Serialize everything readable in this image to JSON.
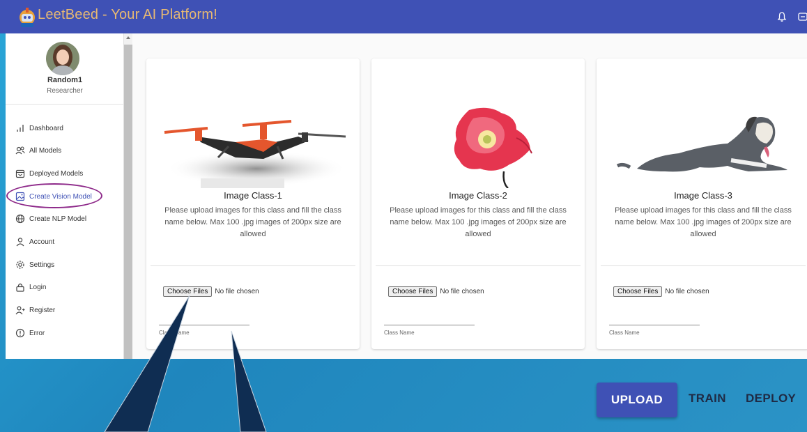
{
  "app": {
    "title": "LeetBeed - Your AI Platform!"
  },
  "user": {
    "name": "Random1",
    "role": "Researcher"
  },
  "sidebar": {
    "items": [
      {
        "label": "Dashboard",
        "icon": "bar-chart-icon"
      },
      {
        "label": "All Models",
        "icon": "users-icon"
      },
      {
        "label": "Deployed Models",
        "icon": "calendar-icon"
      },
      {
        "label": "Create Vision Model",
        "icon": "image-icon",
        "active": true
      },
      {
        "label": "Create NLP Model",
        "icon": "globe-icon"
      },
      {
        "label": "Account",
        "icon": "user-icon"
      },
      {
        "label": "Settings",
        "icon": "gear-icon"
      },
      {
        "label": "Login",
        "icon": "lock-icon"
      },
      {
        "label": "Register",
        "icon": "user-plus-icon"
      },
      {
        "label": "Error",
        "icon": "alert-circle-icon"
      }
    ]
  },
  "cards": [
    {
      "title": "Image Class-1",
      "image": "drone-image",
      "description": "Please upload images for this class and fill the class name below. Max 100 .jpg images of 200px size are allowed",
      "choose_label": "Choose Files",
      "file_status": "No file chosen",
      "class_name_label": "Class Name"
    },
    {
      "title": "Image Class-2",
      "image": "poppy-flower-image",
      "description": "Please upload images for this class and fill the class name below. Max 100 .jpg images of 200px size are allowed",
      "choose_label": "Choose Files",
      "file_status": "No file chosen",
      "class_name_label": "Class Name"
    },
    {
      "title": "Image Class-3",
      "image": "dog-image",
      "description": "Please upload images for this class and fill the class name below. Max 100 .jpg images of 200px size are allowed",
      "choose_label": "Choose Files",
      "file_status": "No file chosen",
      "class_name_label": "Class Name"
    }
  ],
  "actions": {
    "upload": "UPLOAD",
    "train": "TRAIN",
    "deploy": "DEPLOY"
  },
  "colors": {
    "primary": "#3f51b5",
    "title": "#e6b873",
    "highlight": "#8e2a8a",
    "callout": "#0f2d52"
  }
}
